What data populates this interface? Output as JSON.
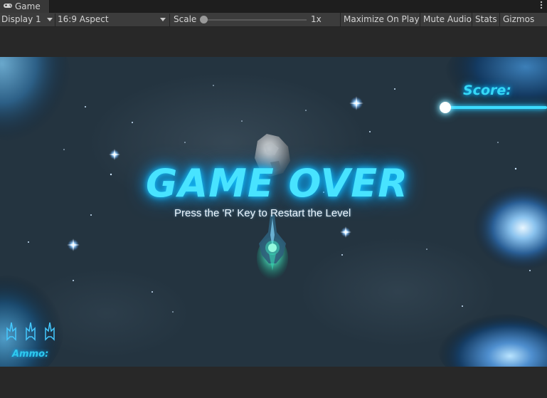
{
  "window": {
    "tab_label": "Game",
    "tab_icon": "gamepad-icon",
    "menu_icon": "kebab-menu-icon"
  },
  "toolbar": {
    "display_label": "Display 1",
    "aspect_label": "16:9 Aspect",
    "scale_label": "Scale",
    "scale_value": "1x",
    "scale_level": 0.0,
    "maximize_label": "Maximize On Play",
    "mute_label": "Mute Audio",
    "stats_label": "Stats",
    "gizmos_label": "Gizmos"
  },
  "game": {
    "score_label": "Score:",
    "game_over_text": "GAME OVER",
    "restart_text": "Press the 'R' Key to Restart the Level",
    "ammo_label": "Ammo:",
    "ammo_icons": [
      "ship-ammo-icon",
      "ship-ammo-icon",
      "ship-ammo-icon"
    ],
    "colors": {
      "ui_glow": "#35d8f6",
      "background": "#243440",
      "text_white": "#eaf6ff"
    }
  }
}
